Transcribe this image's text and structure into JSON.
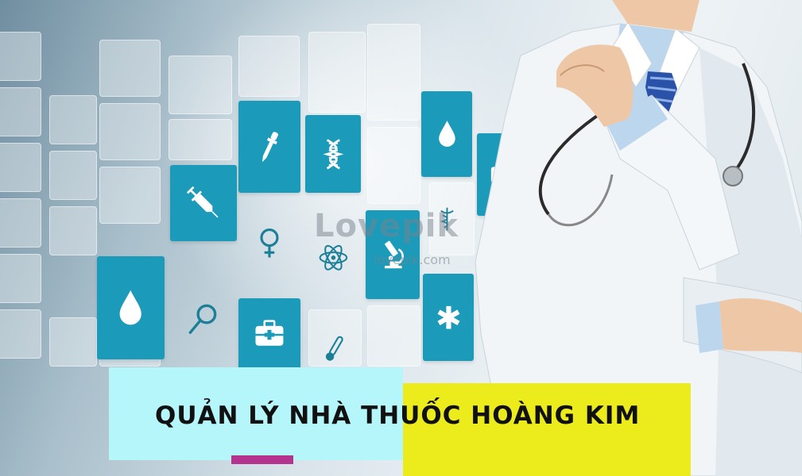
{
  "title": "QUẢN LÝ NHÀ THUỐC HOÀNG KIM",
  "watermark": {
    "brand": "Lovepik",
    "site": "lovepik.com"
  },
  "colors": {
    "tile": "#1b9bb9",
    "band_left": "#b5f6fb",
    "band_right": "#ecec1c",
    "accent": "#b3338f"
  },
  "icons": [
    "pipette-icon",
    "dna-icon",
    "drop-icon",
    "syringe-icon",
    "female-symbol-icon",
    "atom-icon",
    "microscope-icon",
    "caduceus-icon",
    "magnifier-icon",
    "medical-kit-icon",
    "thermometer-icon",
    "star-of-life-icon"
  ]
}
